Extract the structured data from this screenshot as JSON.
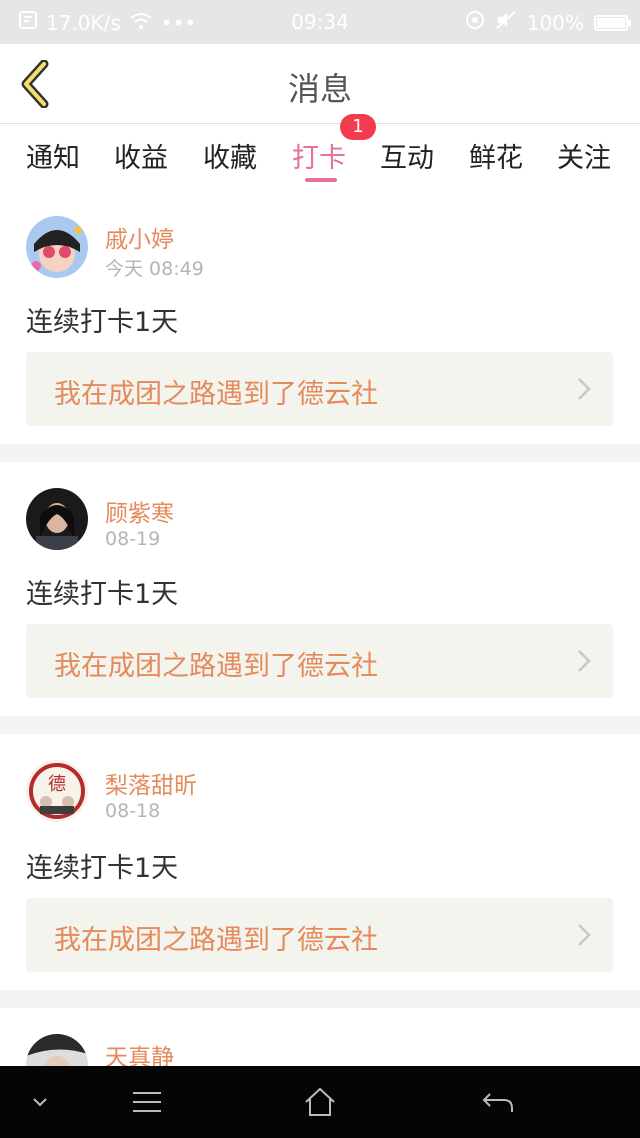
{
  "status_bar": {
    "speed": "17.0K/s",
    "time": "09:34",
    "battery": "100%",
    "battery_level": 1.0
  },
  "header": {
    "title": "消息"
  },
  "tabs": [
    {
      "label": "通知"
    },
    {
      "label": "收益"
    },
    {
      "label": "收藏"
    },
    {
      "label": "打卡",
      "active": true,
      "badge": "1"
    },
    {
      "label": "互动"
    },
    {
      "label": "鲜花"
    },
    {
      "label": "关注"
    }
  ],
  "messages": [
    {
      "user": "戚小婷",
      "time": "今天 08:49",
      "text": "连续打卡1天",
      "link": "我在成团之路遇到了德云社"
    },
    {
      "user": "顾紫寒",
      "time": "08-19",
      "text": "连续打卡1天",
      "link": "我在成团之路遇到了德云社"
    },
    {
      "user": "梨落甜昕",
      "time": "08-18",
      "text": "连续打卡1天",
      "link": "我在成团之路遇到了德云社"
    },
    {
      "user": "天真静"
    }
  ],
  "colors": {
    "accent_pink": "#e8709c",
    "username_orange": "#e58a5a",
    "badge_red": "#f23b4f"
  }
}
